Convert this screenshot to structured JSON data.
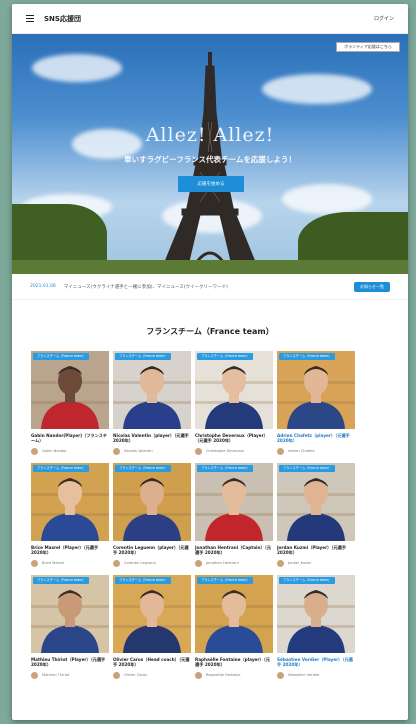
{
  "header": {
    "brand": "SNS応援団",
    "login": "ログイン"
  },
  "hero": {
    "title": "Allez! Allez!",
    "subtitle": "車いすラグビーフランス代表チームを応援しよう！",
    "cta": "応援を始める",
    "corner_button": "ボランティア応援はこちら"
  },
  "news": {
    "date": "2021.01.06",
    "text": "マイニュース(ウクライナ選手と一緒に参加)、マイニュース(ウイークリーワード)",
    "button": "お知らせ一覧"
  },
  "section": {
    "title": "フランスチーム（France team）"
  },
  "players": [
    {
      "tag": "フランスチーム（France team）",
      "name": "Gabin Nandor(Player)（フランスチーム）",
      "author": "Gabin Nandor",
      "highlight": false,
      "bg": "#b9a48e",
      "shirt": "#c0262d",
      "skin": "#6b4a39"
    },
    {
      "tag": "フランスチーム（France team）",
      "name": "Nicolas Valentin（player）（元選手 2020年）",
      "author": "Nicolas Valentin",
      "highlight": false,
      "bg": "#d7d3cc",
      "shirt": "#2a3f8c",
      "skin": "#e0b89a"
    },
    {
      "tag": "フランスチーム（France team）",
      "name": "Christophe Deveraux（Player）（元選手 2020年）",
      "author": "Christophe Deveraux",
      "highlight": false,
      "bg": "#e6e1d8",
      "shirt": "#233b7a",
      "skin": "#e5bd9f"
    },
    {
      "tag": "フランスチーム（France team）",
      "name": "Adrien Chafetz（player）（元選手 2020年）",
      "author": "Adrien Chafetz",
      "highlight": true,
      "bg": "#d9a458",
      "shirt": "#2c4788",
      "skin": "#e2b795"
    },
    {
      "tag": "フランスチーム（France team）",
      "name": "Brice Masrel（Player）（元選手 2020年）",
      "author": "Brice Masrel",
      "highlight": false,
      "bg": "#d2a250",
      "shirt": "#2a4a96",
      "skin": "#e6bf9f"
    },
    {
      "tag": "フランスチーム（France team）",
      "name": "Corentin Leguenn（player）（元選手 2020年）",
      "author": "Corentin Leguenn",
      "highlight": false,
      "bg": "#cf9f4e",
      "shirt": "#2b3f84",
      "skin": "#dcb08e"
    },
    {
      "tag": "フランスチーム（France team）",
      "name": "Jonathan Hentrani（Captain）（元選手 2020年）",
      "author": "Jonathan Hentrani",
      "highlight": false,
      "bg": "#c9bfb2",
      "shirt": "#c2262c",
      "skin": "#e4bb9b"
    },
    {
      "tag": "フランスチーム（France team）",
      "name": "Jordan Kuzmi（Player）（元選手 2020年）",
      "author": "Jordan Kuzmi",
      "highlight": false,
      "bg": "#cfc7ba",
      "shirt": "#24397a",
      "skin": "#e0b392"
    },
    {
      "tag": "フランスチーム（France team）",
      "name": "Mathieu Thiriot（Player）（元選手 2020年）",
      "author": "Mathieu Thiriot",
      "highlight": false,
      "bg": "#d5c4a6",
      "shirt": "#2a4688",
      "skin": "#c99a78"
    },
    {
      "tag": "フランスチーム（France team）",
      "name": "Olivier Caros（Head coach）（元選手 2020年）",
      "author": "Olivier Caros",
      "highlight": false,
      "bg": "#d8a857",
      "shirt": "#24386f",
      "skin": "#e3b899"
    },
    {
      "tag": "フランスチーム（France team）",
      "name": "Raphaëlle Fontaine（player）（元選手 2020年）",
      "author": "Raphaëlle Fontaine",
      "highlight": false,
      "bg": "#d4a34f",
      "shirt": "#2a4b96",
      "skin": "#e4bc9c"
    },
    {
      "tag": "フランスチーム（France team）",
      "name": "Sébastien Verdier（Player）（元選手 2020年）",
      "author": "Sébastien Verdier",
      "highlight": true,
      "bg": "#dcd8d0",
      "shirt": "#233a7c",
      "skin": "#d9ae8c"
    }
  ]
}
